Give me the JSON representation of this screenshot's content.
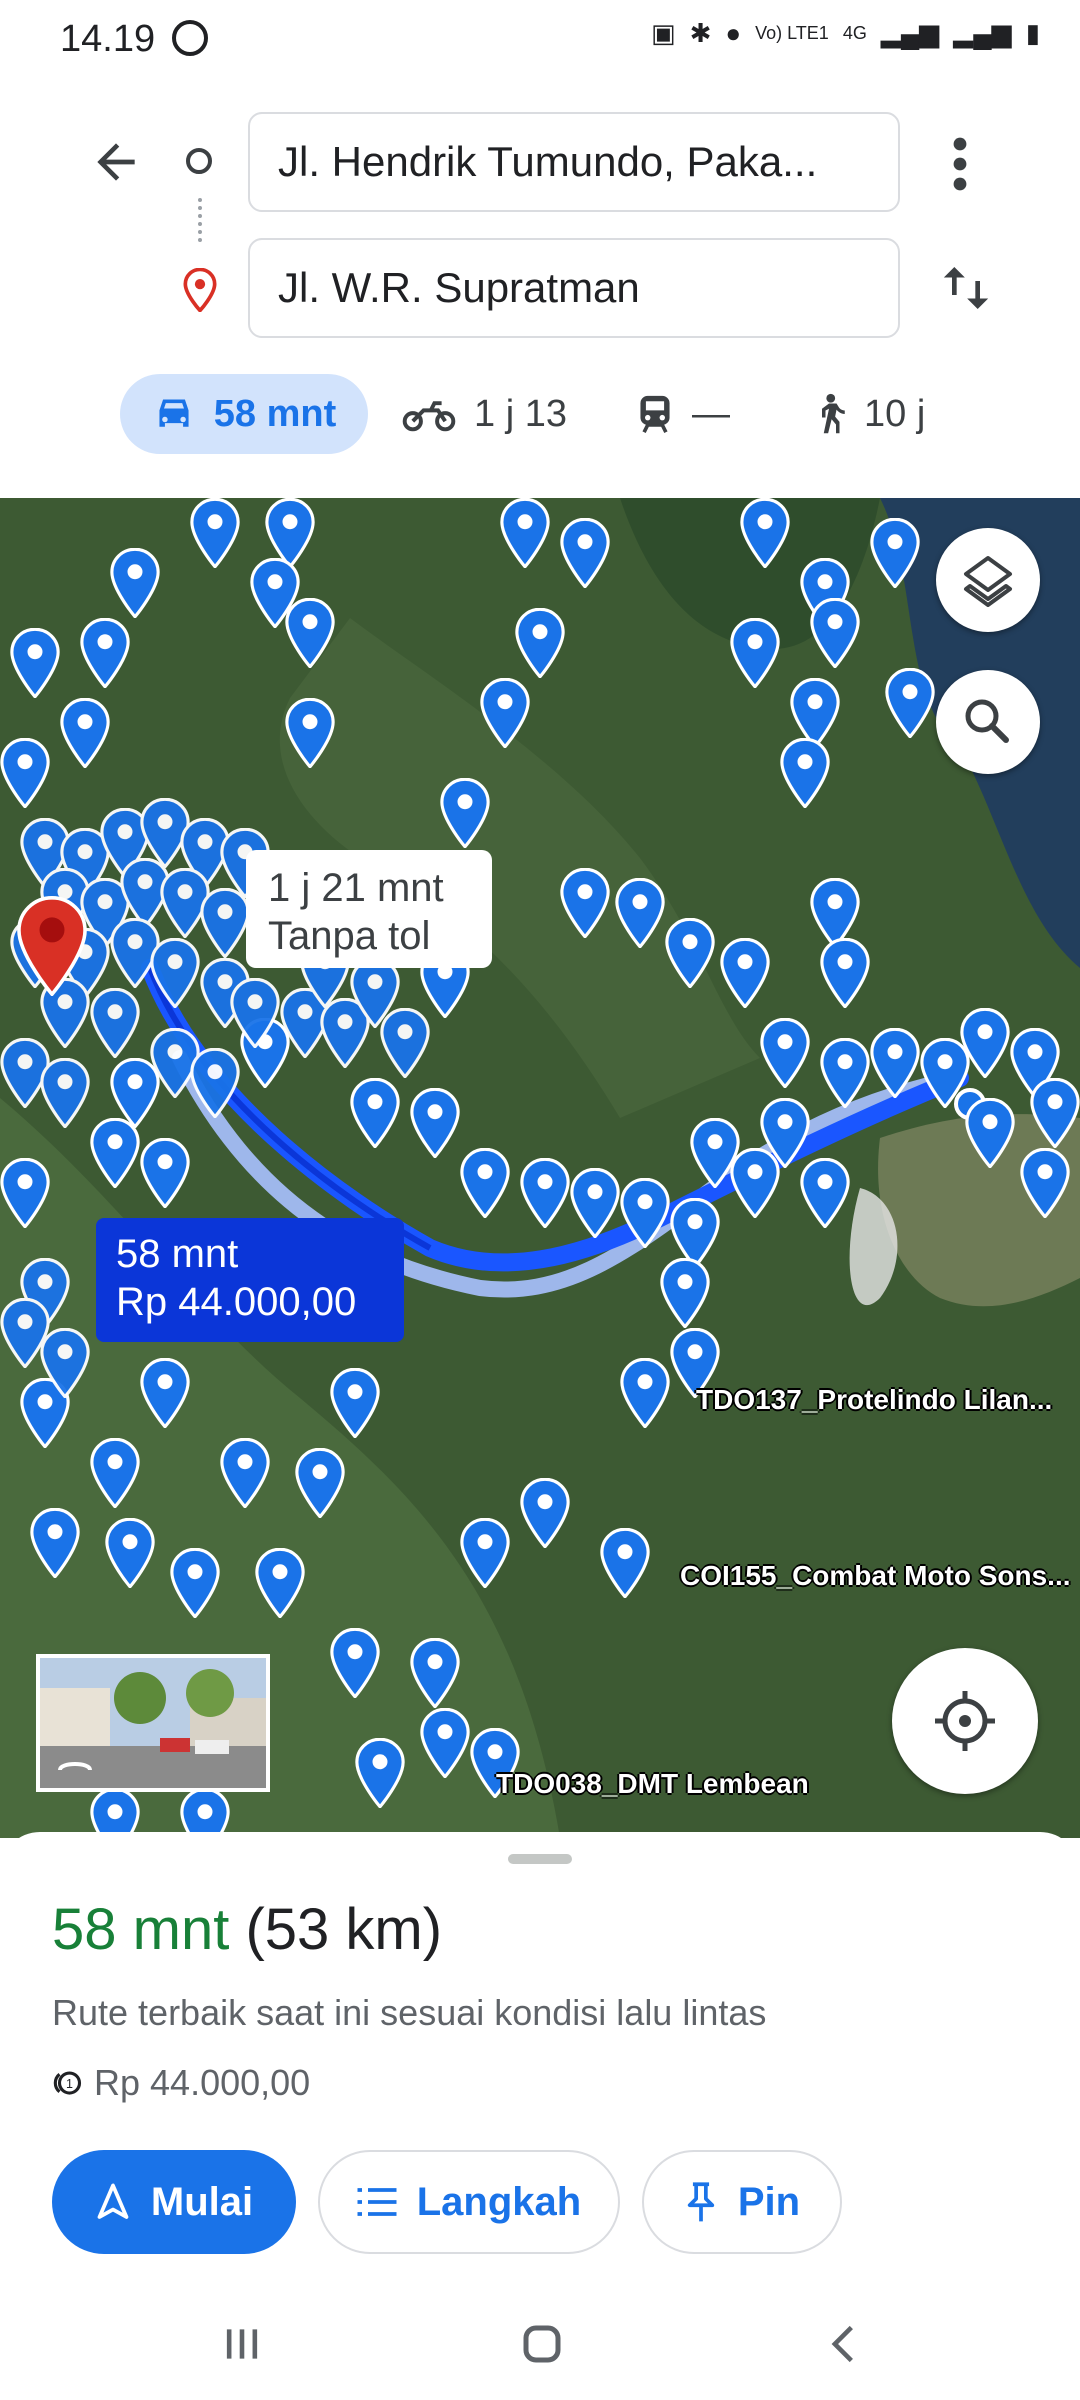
{
  "status_bar": {
    "time": "14.19",
    "network_label": "Vo) LTE1",
    "network_type": "4G"
  },
  "route": {
    "origin": "Jl. Hendrik Tumundo, Paka...",
    "destination": "Jl. W.R. Supratman"
  },
  "modes": [
    {
      "name": "car",
      "label": "58 mnt"
    },
    {
      "name": "motorcycle",
      "label": "1 j 13"
    },
    {
      "name": "transit",
      "label": "—"
    },
    {
      "name": "walk",
      "label": "10 j"
    }
  ],
  "map": {
    "alt_route_line1": "1 j 21 mnt",
    "alt_route_line2": "Tanpa tol",
    "main_route_line1": "58 mnt",
    "main_route_line2": "Rp 44.000,00",
    "labels": [
      "TDO137_Protelindo Lilan...",
      "COI155_Combat Moto Sons...",
      "TDO038_DMT Lembean"
    ],
    "pin_color": "#1a73e8",
    "route_color": "#1a56ff"
  },
  "sheet": {
    "eta_time": "58 mnt",
    "eta_distance": "(53 km)",
    "description": "Rute terbaik saat ini sesuai kondisi lalu lintas",
    "toll": "Rp 44.000,00",
    "buttons": {
      "start": "Mulai",
      "steps": "Langkah",
      "pin": "Pin"
    }
  },
  "icons": [
    "whatsapp-icon",
    "back-arrow-icon",
    "origin-circle-icon",
    "destination-pin-icon",
    "more-vert-icon",
    "swap-icon",
    "car-icon",
    "motorcycle-icon",
    "transit-icon",
    "walk-icon",
    "layers-icon",
    "search-icon",
    "my-location-icon",
    "toll-icon",
    "navigation-icon",
    "list-icon",
    "pin-icon"
  ]
}
